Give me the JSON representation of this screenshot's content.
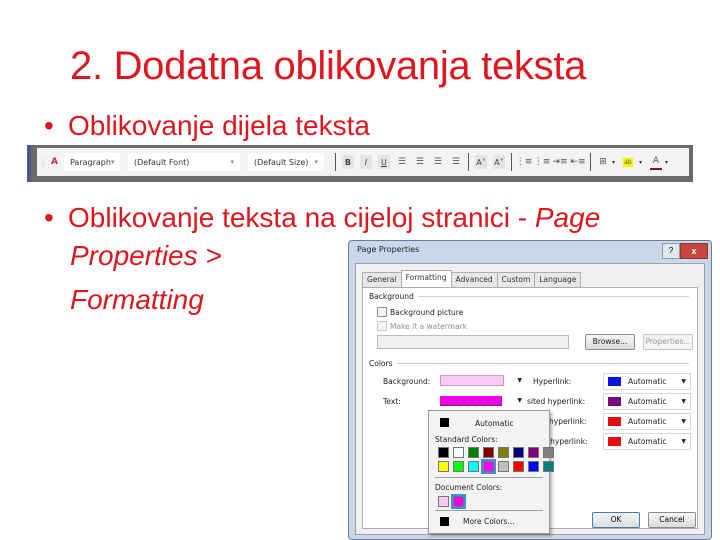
{
  "slide": {
    "title": "2. Dodatna oblikovanja teksta",
    "bullets": [
      {
        "symbol": "•",
        "text": "Oblikovanje dijela teksta"
      },
      {
        "symbol": "•",
        "text_normal": "Oblikovanje teksta na cijeloj stranici - ",
        "text_italic": "Page",
        "continuation": [
          "Properties >",
          "Formatting"
        ]
      }
    ]
  },
  "toolbar": {
    "style_icon": "style-icon",
    "paragraph_select": "Paragraph",
    "font_select": "(Default Font)",
    "size_select": "(Default Size)",
    "buttons": [
      "B",
      "I",
      "U"
    ],
    "align_glyph": "☰",
    "grow_font": "A˄",
    "shrink_font": "A˅",
    "list_glyphs": [
      "⋮≡",
      "⋮≡",
      "⇥≡",
      "⇤≡"
    ],
    "border_glyph": "⊞",
    "highlight_glyph": "ab",
    "font_color_glyph": "A",
    "dropdown_arrow": "▾",
    "colors": {
      "highlight": "#f5f500",
      "font_color": "#7a1a1a"
    }
  },
  "dialog": {
    "title": "Page Properties",
    "help": "?",
    "close": "x",
    "tabs": [
      "General",
      "Formatting",
      "Advanced",
      "Custom",
      "Language"
    ],
    "active_tab": "Formatting",
    "background_group": "Background",
    "background_picture": {
      "label": "Background picture",
      "checked": false
    },
    "watermark": {
      "label": "Make it a watermark",
      "checked": false,
      "disabled": true
    },
    "browse_button": "Browse...",
    "properties_button": "Properties...",
    "colors_group": "Colors",
    "background_label": "Background:",
    "background_color": "#fbc8f5",
    "text_label": "Text:",
    "text_color": "#f000e8",
    "hyperlinks": [
      {
        "label": "Hyperlink:",
        "value": "Automatic",
        "color": "#0a14e0"
      },
      {
        "label": "sited hyperlink:",
        "value": "Automatic",
        "color": "#7a0a7a"
      },
      {
        "label": "hyperlink:",
        "value": "Automatic",
        "color": "#e01010"
      },
      {
        "label": "d hyperlink:",
        "value": "Automatic",
        "color": "#e01010"
      }
    ],
    "ok_button": "OK",
    "cancel_button": "Cancel"
  },
  "color_popup": {
    "automatic_label": "Automatic",
    "automatic_color": "#000000",
    "standard_label": "Standard Colors:",
    "standard_row1": [
      "#000000",
      "#ffffff",
      "#008000",
      "#800000",
      "#808000",
      "#000080",
      "#800080",
      "#808080"
    ],
    "standard_row2": [
      "#ffff00",
      "#00ff00",
      "#00ffff",
      "#ff00ff",
      "#c0c0c0",
      "#ff0000",
      "#0000ff",
      "#008080"
    ],
    "selected_standard_index_row2": 3,
    "document_label": "Document Colors:",
    "document_colors": [
      "#fbc8f5",
      "#f000e8"
    ],
    "selected_document_index": 1,
    "more_colors_label": "More Colors...",
    "more_colors_swatch": "#000000"
  }
}
